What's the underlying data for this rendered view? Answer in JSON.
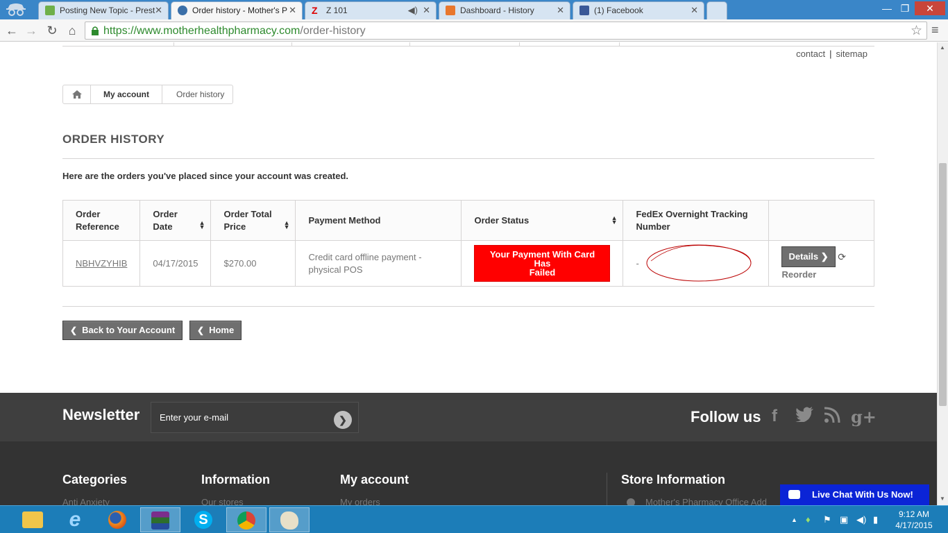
{
  "browser": {
    "tabs": [
      {
        "title": "Posting New Topic - Prest",
        "active": false
      },
      {
        "title": "Order history - Mother's P",
        "active": true
      },
      {
        "title": "Z 101",
        "active": false
      },
      {
        "title": "Dashboard - History",
        "active": false
      },
      {
        "title": "(1) Facebook",
        "active": false
      }
    ],
    "url_host": "https://www.motherhealthpharmacy.com",
    "url_path": "/order-history"
  },
  "header": {
    "contact_label": "contact",
    "separator": "|",
    "sitemap_label": "sitemap"
  },
  "breadcrumb": {
    "items": [
      "My account",
      "Order history"
    ]
  },
  "page": {
    "title": "ORDER HISTORY",
    "intro": "Here are the orders you've placed since your account was created."
  },
  "orders_table": {
    "headers": {
      "reference": [
        "Order",
        "Reference"
      ],
      "date": [
        "Order",
        "Date"
      ],
      "total": [
        "Order Total",
        "Price"
      ],
      "payment": "Payment Method",
      "status": "Order Status",
      "tracking": [
        "FedEx Overnight Tracking",
        "Number"
      ]
    },
    "rows": [
      {
        "reference": "NBHVZYHIB",
        "date": "04/17/2015",
        "total": "$270.00",
        "payment": [
          "Credit card offline payment -",
          "physical POS"
        ],
        "status": [
          "Your Payment With Card Has",
          "Failed"
        ],
        "status_color": "#ff0000",
        "tracking": "-",
        "details_label": "Details",
        "reorder_label": "Reorder"
      }
    ]
  },
  "buttons": {
    "back_label": "Back to Your Account",
    "home_label": "Home"
  },
  "newsletter": {
    "label": "Newsletter",
    "input_value": "Enter your e-mail",
    "follow_label": "Follow us"
  },
  "footer": {
    "columns": [
      {
        "title": "Categories",
        "first_item": "Anti Anxiety"
      },
      {
        "title": "Information",
        "first_item": "Our stores"
      },
      {
        "title": "My account",
        "first_item": "My orders"
      },
      {
        "title": "Store Information",
        "first_item": "Mother's Pharmacy Office Add"
      }
    ]
  },
  "livechat": {
    "label": "Live Chat With Us Now!",
    "color": "#0b24d6"
  },
  "taskbar": {
    "time": "9:12 AM",
    "date": "4/17/2015"
  }
}
